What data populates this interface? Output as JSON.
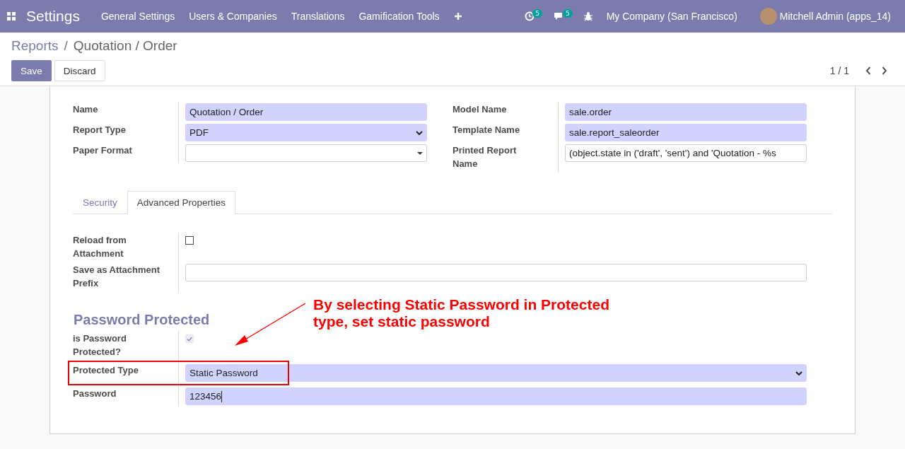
{
  "navbar": {
    "app_title": "Settings",
    "menu": [
      "General Settings",
      "Users & Companies",
      "Translations",
      "Gamification Tools"
    ],
    "activity_count": "5",
    "message_count": "5",
    "company": "My Company (San Francisco)",
    "user": "Mitchell Admin (apps_14)"
  },
  "breadcrumb": {
    "separator": "/",
    "items": [
      {
        "label": "Reports",
        "link": true
      },
      {
        "label": "Quotation / Order",
        "link": false
      }
    ]
  },
  "buttons": [
    {
      "label": "Save",
      "kind": "primary"
    },
    {
      "label": "Discard",
      "kind": "secondary"
    }
  ],
  "pager": "1 / 1",
  "left_fields": [
    {
      "label": "Name",
      "kind": "input",
      "value": "Quotation / Order",
      "required": true
    },
    {
      "label": "Report Type",
      "kind": "select",
      "value": "PDF",
      "required": true
    },
    {
      "label": "Paper Format",
      "kind": "combo",
      "required": false
    }
  ],
  "right_fields": [
    {
      "label": "Model Name",
      "kind": "input",
      "value": "sale.order",
      "required": true
    },
    {
      "label": "Template Name",
      "kind": "input",
      "value": "sale.report_saleorder",
      "required": true
    },
    {
      "label": "Printed Report Name",
      "kind": "input",
      "value": "(object.state in ('draft', 'sent') and 'Quotation - %s",
      "required": false
    }
  ],
  "tabs": [
    {
      "label": "Security",
      "selected": false
    },
    {
      "label": "Advanced Properties",
      "selected": true
    }
  ],
  "advanced_fields": [
    {
      "label": "Reload from Attachment",
      "kind": "checkbox",
      "checked": false
    },
    {
      "label": "Save as Attachment Prefix",
      "kind": "input",
      "required": false
    }
  ],
  "section_title": "Password Protected",
  "password_fields": [
    {
      "label": "is Password Protected?",
      "kind": "checkbox",
      "checked": true,
      "highlighted": false
    },
    {
      "label": "Protected Type",
      "kind": "select",
      "value": "Static Password",
      "required": true,
      "highlighted": true
    },
    {
      "label": "Password",
      "kind": "input",
      "value": "123456",
      "required": true,
      "highlighted": false
    }
  ],
  "annotation": {
    "text": "By selecting Static Password in Protected type, set static password"
  }
}
